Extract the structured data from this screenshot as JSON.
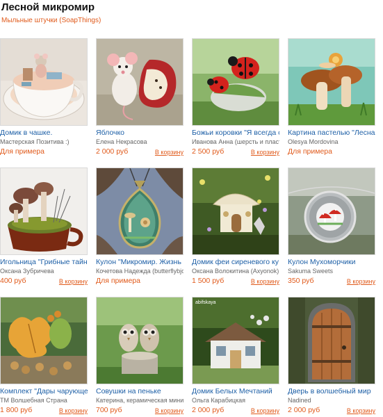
{
  "page": {
    "title": "Лесной микромир",
    "subtitle": "Мыльные штучки (SoapThings)"
  },
  "items": [
    {
      "name": "Домик в чашке.",
      "author": "Мастерская Позитива :)",
      "price": "Для примера",
      "cart": "",
      "image": "teacup-mouse-house"
    },
    {
      "name": "Яблочко",
      "author": "Елена Некрасова",
      "price": "2 000 руб",
      "cart": "В корзину",
      "image": "mouse-and-apple"
    },
    {
      "name": "Божьи коровки \"Я всегда с",
      "author": "Иванова Анна (шерсть и пласт",
      "price": "2 500 руб",
      "cart": "В корзину",
      "image": "ladybugs-on-stone"
    },
    {
      "name": "Картина пастелью \"Лесная",
      "author": "Olesya Mordovina",
      "price": "Для примера",
      "cart": "",
      "image": "mushrooms-with-snail"
    },
    {
      "name": "Игольница \"Грибные тайн",
      "author": "Оксана Зубричева",
      "price": "400 руб",
      "cart": "В корзину",
      "image": "pincushion-mushrooms-cup"
    },
    {
      "name": "Кулон \"Микромир. Жизнь в",
      "author": "Кочетова Надежда (butterflybjo",
      "price": "Для примера",
      "cart": "",
      "image": "pendant-snail-microworld"
    },
    {
      "name": "Домик феи сиреневого ку",
      "author": "Оксана Волокитина (Axyonok)",
      "price": "1 500 руб",
      "cart": "В корзину",
      "image": "fairy-house-lilac"
    },
    {
      "name": "Кулон Мухоморчики",
      "author": "Sakuma Sweets",
      "price": "350 руб",
      "cart": "В корзину",
      "image": "pendant-fly-agarics"
    },
    {
      "name": "Комплект \"Дары чарующе",
      "author": "ТМ Волшебная Страна",
      "price": "1 800 руб",
      "cart": "В корзину",
      "image": "oak-leaves-acorns"
    },
    {
      "name": "Совушки на пеньке",
      "author": "Катерина, керамическая мини",
      "price": "700 руб",
      "cart": "В корзину",
      "image": "owls-on-stump"
    },
    {
      "name": "Домик Белых Мечтаний",
      "author": "Ольга Карабицкая",
      "price": "2 000 руб",
      "cart": "В корзину",
      "image": "white-dreams-house",
      "watermark": "abifskaya"
    },
    {
      "name": "Дверь в волшебный мир",
      "author": "Nadined",
      "price": "2 000 руб",
      "cart": "В корзину",
      "image": "magic-door"
    }
  ]
}
